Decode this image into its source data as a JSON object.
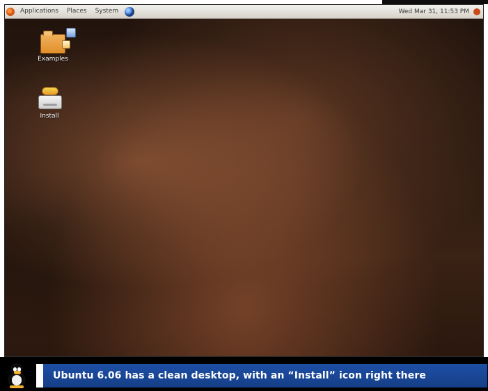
{
  "panel": {
    "menus": [
      "Applications",
      "Places",
      "System"
    ],
    "clock": "Wed Mar 31, 11:53 PM",
    "clock_prefix": "Wed Mar 31, 11:53 PM"
  },
  "desktop": {
    "icons": [
      {
        "label": "Examples",
        "icon": "folder-icon"
      },
      {
        "label": "Install",
        "icon": "install-icon"
      }
    ]
  },
  "caption": {
    "text": "Ubuntu 6.06 has a clean desktop, with an “Install” icon right there",
    "accent_color": "#1e4fa6"
  }
}
